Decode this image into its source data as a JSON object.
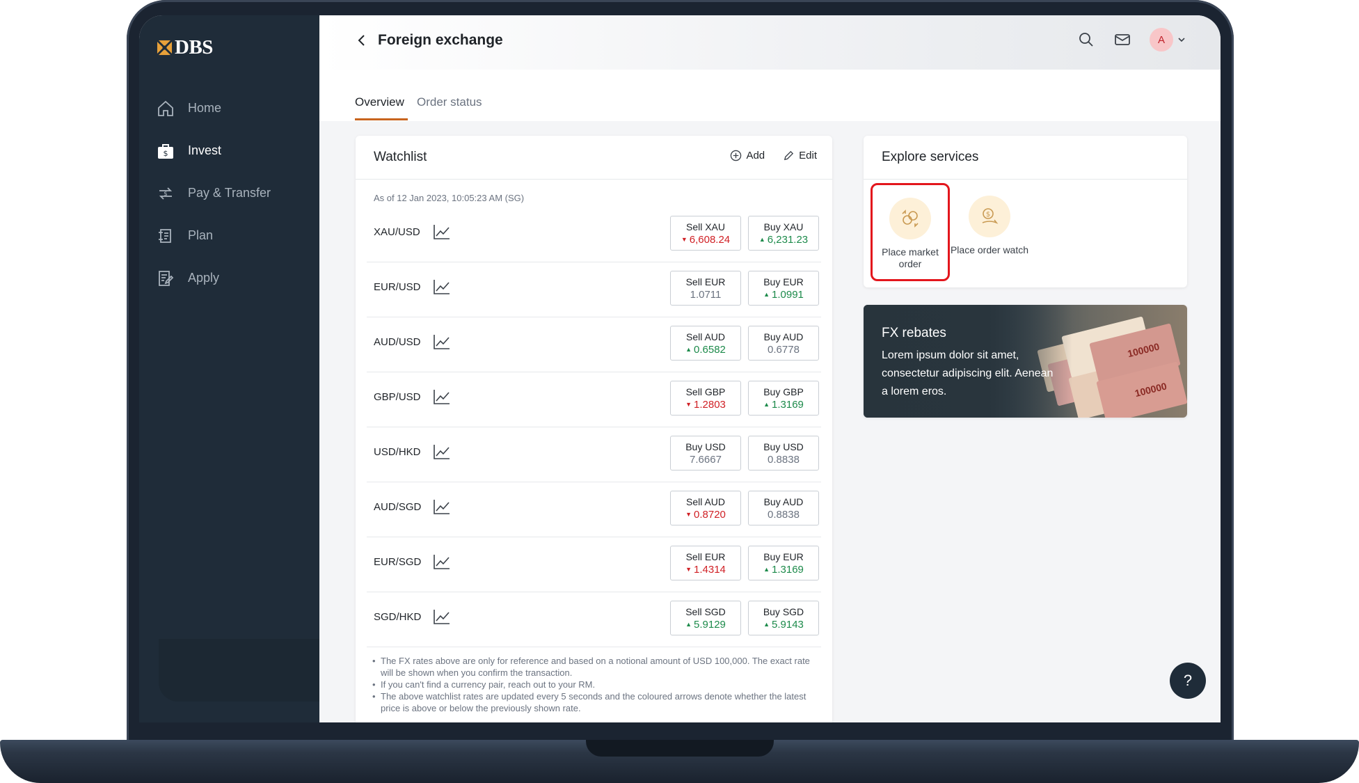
{
  "brand": {
    "name": "DBS",
    "accent": "#c8641e",
    "sidebar_bg": "#1f2c39",
    "up_color": "#1c8a4a",
    "down_color": "#d01f24"
  },
  "sidebar": {
    "items": [
      {
        "label": "Home",
        "icon": "home-icon",
        "active": false
      },
      {
        "label": "Invest",
        "icon": "invest-bag-icon",
        "active": true
      },
      {
        "label": "Pay & Transfer",
        "icon": "pay-transfer-icon",
        "active": false
      },
      {
        "label": "Plan",
        "icon": "plan-icon",
        "active": false
      },
      {
        "label": "Apply",
        "icon": "apply-form-icon",
        "active": false
      }
    ]
  },
  "header": {
    "title": "Foreign exchange",
    "icons": [
      "back-chevron-icon",
      "search-icon",
      "mail-icon",
      "chevron-down-icon"
    ],
    "avatar_initial": "A"
  },
  "tabs": [
    {
      "label": "Overview",
      "active": true
    },
    {
      "label": "Order status",
      "active": false
    }
  ],
  "watchlist": {
    "title": "Watchlist",
    "add_label": "Add",
    "edit_label": "Edit",
    "as_of": "As of 12 Jan 2023, 10:05:23 AM (SG)",
    "rows": [
      {
        "pair": "XAU/USD",
        "left_label": "Sell XAU",
        "left_value": "6,608.24",
        "left_dir": "down",
        "right_label": "Buy XAU",
        "right_value": "6,231.23",
        "right_dir": "up"
      },
      {
        "pair": "EUR/USD",
        "left_label": "Sell EUR",
        "left_value": "1.0711",
        "left_dir": "none",
        "right_label": "Buy EUR",
        "right_value": "1.0991",
        "right_dir": "up"
      },
      {
        "pair": "AUD/USD",
        "left_label": "Sell AUD",
        "left_value": "0.6582",
        "left_dir": "up",
        "right_label": "Buy AUD",
        "right_value": "0.6778",
        "right_dir": "none"
      },
      {
        "pair": "GBP/USD",
        "left_label": "Sell GBP",
        "left_value": "1.2803",
        "left_dir": "down",
        "right_label": "Buy GBP",
        "right_value": "1.3169",
        "right_dir": "up"
      },
      {
        "pair": "USD/HKD",
        "left_label": "Buy USD",
        "left_value": "7.6667",
        "left_dir": "none",
        "right_label": "Buy USD",
        "right_value": "0.8838",
        "right_dir": "none"
      },
      {
        "pair": "AUD/SGD",
        "left_label": "Sell AUD",
        "left_value": "0.8720",
        "left_dir": "down",
        "right_label": "Buy AUD",
        "right_value": "0.8838",
        "right_dir": "none"
      },
      {
        "pair": "EUR/SGD",
        "left_label": "Sell EUR",
        "left_value": "1.4314",
        "left_dir": "down",
        "right_label": "Buy EUR",
        "right_value": "1.3169",
        "right_dir": "up"
      },
      {
        "pair": "SGD/HKD",
        "left_label": "Sell SGD",
        "left_value": "5.9129",
        "left_dir": "up",
        "right_label": "Buy SGD",
        "right_value": "5.9143",
        "right_dir": "up"
      }
    ],
    "notes": [
      "The FX rates above are only for reference and based on a notional amount of USD 100,000. The exact rate will be shown when you confirm the transaction.",
      "If you can't find a currency pair, reach out to your RM.",
      "The above watchlist rates are updated every 5 seconds and the coloured arrows denote whether the latest price is above or below the previously shown rate."
    ]
  },
  "explore": {
    "title": "Explore services",
    "services": [
      {
        "label": "Place market order",
        "icon": "currency-exchange-icon",
        "highlighted": true
      },
      {
        "label": "Place order watch",
        "icon": "dollar-watch-icon",
        "highlighted": false
      }
    ]
  },
  "rebates": {
    "title": "FX rebates",
    "body": "Lorem ipsum dolor sit amet, consectetur adipiscing elit. Aenean a lorem eros.",
    "bill_text": "100000"
  },
  "help": {
    "label": "?"
  }
}
